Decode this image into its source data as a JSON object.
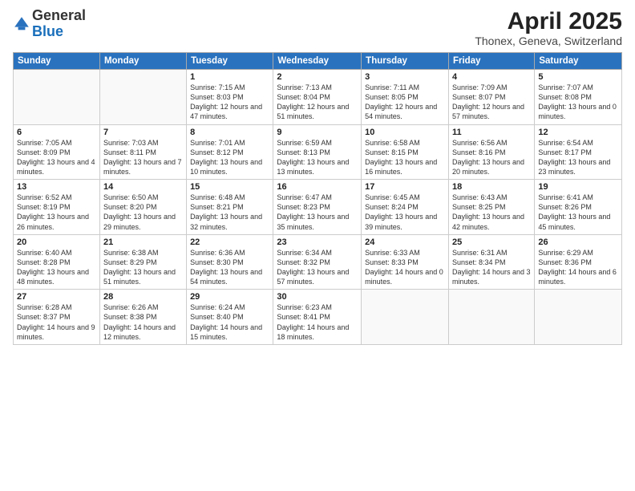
{
  "header": {
    "logo_general": "General",
    "logo_blue": "Blue",
    "month": "April 2025",
    "location": "Thonex, Geneva, Switzerland"
  },
  "days_of_week": [
    "Sunday",
    "Monday",
    "Tuesday",
    "Wednesday",
    "Thursday",
    "Friday",
    "Saturday"
  ],
  "weeks": [
    [
      {
        "day": "",
        "info": ""
      },
      {
        "day": "",
        "info": ""
      },
      {
        "day": "1",
        "info": "Sunrise: 7:15 AM\nSunset: 8:03 PM\nDaylight: 12 hours and 47 minutes."
      },
      {
        "day": "2",
        "info": "Sunrise: 7:13 AM\nSunset: 8:04 PM\nDaylight: 12 hours and 51 minutes."
      },
      {
        "day": "3",
        "info": "Sunrise: 7:11 AM\nSunset: 8:05 PM\nDaylight: 12 hours and 54 minutes."
      },
      {
        "day": "4",
        "info": "Sunrise: 7:09 AM\nSunset: 8:07 PM\nDaylight: 12 hours and 57 minutes."
      },
      {
        "day": "5",
        "info": "Sunrise: 7:07 AM\nSunset: 8:08 PM\nDaylight: 13 hours and 0 minutes."
      }
    ],
    [
      {
        "day": "6",
        "info": "Sunrise: 7:05 AM\nSunset: 8:09 PM\nDaylight: 13 hours and 4 minutes."
      },
      {
        "day": "7",
        "info": "Sunrise: 7:03 AM\nSunset: 8:11 PM\nDaylight: 13 hours and 7 minutes."
      },
      {
        "day": "8",
        "info": "Sunrise: 7:01 AM\nSunset: 8:12 PM\nDaylight: 13 hours and 10 minutes."
      },
      {
        "day": "9",
        "info": "Sunrise: 6:59 AM\nSunset: 8:13 PM\nDaylight: 13 hours and 13 minutes."
      },
      {
        "day": "10",
        "info": "Sunrise: 6:58 AM\nSunset: 8:15 PM\nDaylight: 13 hours and 16 minutes."
      },
      {
        "day": "11",
        "info": "Sunrise: 6:56 AM\nSunset: 8:16 PM\nDaylight: 13 hours and 20 minutes."
      },
      {
        "day": "12",
        "info": "Sunrise: 6:54 AM\nSunset: 8:17 PM\nDaylight: 13 hours and 23 minutes."
      }
    ],
    [
      {
        "day": "13",
        "info": "Sunrise: 6:52 AM\nSunset: 8:19 PM\nDaylight: 13 hours and 26 minutes."
      },
      {
        "day": "14",
        "info": "Sunrise: 6:50 AM\nSunset: 8:20 PM\nDaylight: 13 hours and 29 minutes."
      },
      {
        "day": "15",
        "info": "Sunrise: 6:48 AM\nSunset: 8:21 PM\nDaylight: 13 hours and 32 minutes."
      },
      {
        "day": "16",
        "info": "Sunrise: 6:47 AM\nSunset: 8:23 PM\nDaylight: 13 hours and 35 minutes."
      },
      {
        "day": "17",
        "info": "Sunrise: 6:45 AM\nSunset: 8:24 PM\nDaylight: 13 hours and 39 minutes."
      },
      {
        "day": "18",
        "info": "Sunrise: 6:43 AM\nSunset: 8:25 PM\nDaylight: 13 hours and 42 minutes."
      },
      {
        "day": "19",
        "info": "Sunrise: 6:41 AM\nSunset: 8:26 PM\nDaylight: 13 hours and 45 minutes."
      }
    ],
    [
      {
        "day": "20",
        "info": "Sunrise: 6:40 AM\nSunset: 8:28 PM\nDaylight: 13 hours and 48 minutes."
      },
      {
        "day": "21",
        "info": "Sunrise: 6:38 AM\nSunset: 8:29 PM\nDaylight: 13 hours and 51 minutes."
      },
      {
        "day": "22",
        "info": "Sunrise: 6:36 AM\nSunset: 8:30 PM\nDaylight: 13 hours and 54 minutes."
      },
      {
        "day": "23",
        "info": "Sunrise: 6:34 AM\nSunset: 8:32 PM\nDaylight: 13 hours and 57 minutes."
      },
      {
        "day": "24",
        "info": "Sunrise: 6:33 AM\nSunset: 8:33 PM\nDaylight: 14 hours and 0 minutes."
      },
      {
        "day": "25",
        "info": "Sunrise: 6:31 AM\nSunset: 8:34 PM\nDaylight: 14 hours and 3 minutes."
      },
      {
        "day": "26",
        "info": "Sunrise: 6:29 AM\nSunset: 8:36 PM\nDaylight: 14 hours and 6 minutes."
      }
    ],
    [
      {
        "day": "27",
        "info": "Sunrise: 6:28 AM\nSunset: 8:37 PM\nDaylight: 14 hours and 9 minutes."
      },
      {
        "day": "28",
        "info": "Sunrise: 6:26 AM\nSunset: 8:38 PM\nDaylight: 14 hours and 12 minutes."
      },
      {
        "day": "29",
        "info": "Sunrise: 6:24 AM\nSunset: 8:40 PM\nDaylight: 14 hours and 15 minutes."
      },
      {
        "day": "30",
        "info": "Sunrise: 6:23 AM\nSunset: 8:41 PM\nDaylight: 14 hours and 18 minutes."
      },
      {
        "day": "",
        "info": ""
      },
      {
        "day": "",
        "info": ""
      },
      {
        "day": "",
        "info": ""
      }
    ]
  ]
}
